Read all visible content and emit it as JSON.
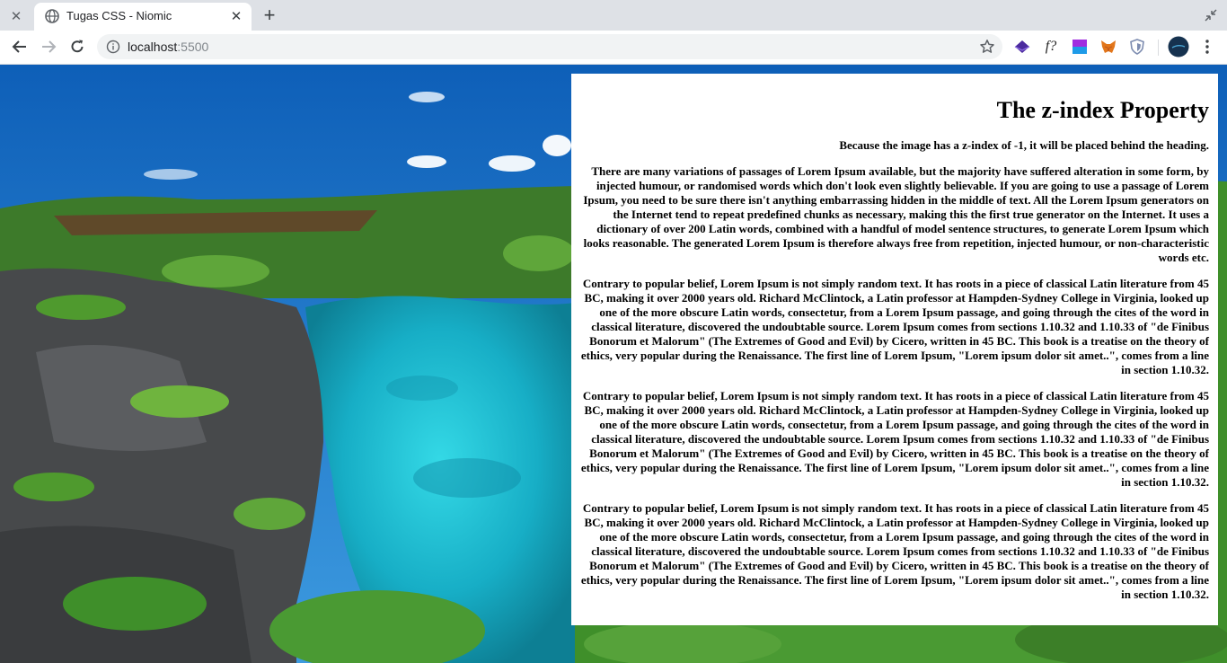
{
  "browser": {
    "inactive_tab_close": "✕",
    "active_tab": {
      "title": "Tugas CSS - Niomic",
      "close": "✕"
    },
    "new_tab": "+",
    "address": {
      "host": "localhost",
      "port": ":5500"
    },
    "extensions": [
      "layers-icon",
      "font-finder-icon",
      "color-picker-icon",
      "metamask-fox-icon",
      "shield-icon"
    ],
    "extension_glyph_f": "f?"
  },
  "page": {
    "heading": "The z-index Property",
    "intro": "Because the image has a z-index of -1, it will be placed behind the heading.",
    "paragraphs": [
      "There are many variations of passages of Lorem Ipsum available, but the majority have suffered alteration in some form, by injected humour, or randomised words which don't look even slightly believable. If you are going to use a passage of Lorem Ipsum, you need to be sure there isn't anything embarrassing hidden in the middle of text. All the Lorem Ipsum generators on the Internet tend to repeat predefined chunks as necessary, making this the first true generator on the Internet. It uses a dictionary of over 200 Latin words, combined with a handful of model sentence structures, to generate Lorem Ipsum which looks reasonable. The generated Lorem Ipsum is therefore always free from repetition, injected humour, or non-characteristic words etc.",
      "Contrary to popular belief, Lorem Ipsum is not simply random text. It has roots in a piece of classical Latin literature from 45 BC, making it over 2000 years old. Richard McClintock, a Latin professor at Hampden-Sydney College in Virginia, looked up one of the more obscure Latin words, consectetur, from a Lorem Ipsum passage, and going through the cites of the word in classical literature, discovered the undoubtable source. Lorem Ipsum comes from sections 1.10.32 and 1.10.33 of \"de Finibus Bonorum et Malorum\" (The Extremes of Good and Evil) by Cicero, written in 45 BC. This book is a treatise on the theory of ethics, very popular during the Renaissance. The first line of Lorem Ipsum, \"Lorem ipsum dolor sit amet..\", comes from a line in section 1.10.32.",
      "Contrary to popular belief, Lorem Ipsum is not simply random text. It has roots in a piece of classical Latin literature from 45 BC, making it over 2000 years old. Richard McClintock, a Latin professor at Hampden-Sydney College in Virginia, looked up one of the more obscure Latin words, consectetur, from a Lorem Ipsum passage, and going through the cites of the word in classical literature, discovered the undoubtable source. Lorem Ipsum comes from sections 1.10.32 and 1.10.33 of \"de Finibus Bonorum et Malorum\" (The Extremes of Good and Evil) by Cicero, written in 45 BC. This book is a treatise on the theory of ethics, very popular during the Renaissance. The first line of Lorem Ipsum, \"Lorem ipsum dolor sit amet..\", comes from a line in section 1.10.32.",
      "Contrary to popular belief, Lorem Ipsum is not simply random text. It has roots in a piece of classical Latin literature from 45 BC, making it over 2000 years old. Richard McClintock, a Latin professor at Hampden-Sydney College in Virginia, looked up one of the more obscure Latin words, consectetur, from a Lorem Ipsum passage, and going through the cites of the word in classical literature, discovered the undoubtable source. Lorem Ipsum comes from sections 1.10.32 and 1.10.33 of \"de Finibus Bonorum et Malorum\" (The Extremes of Good and Evil) by Cicero, written in 45 BC. This book is a treatise on the theory of ethics, very popular during the Renaissance. The first line of Lorem Ipsum, \"Lorem ipsum dolor sit amet..\", comes from a line in section 1.10.32."
    ]
  },
  "colors": {
    "sky": "#1a6fc4",
    "lagoon": "#22c4d6",
    "foliage": "#3f8f2a",
    "rock": "#4a4c4e"
  }
}
